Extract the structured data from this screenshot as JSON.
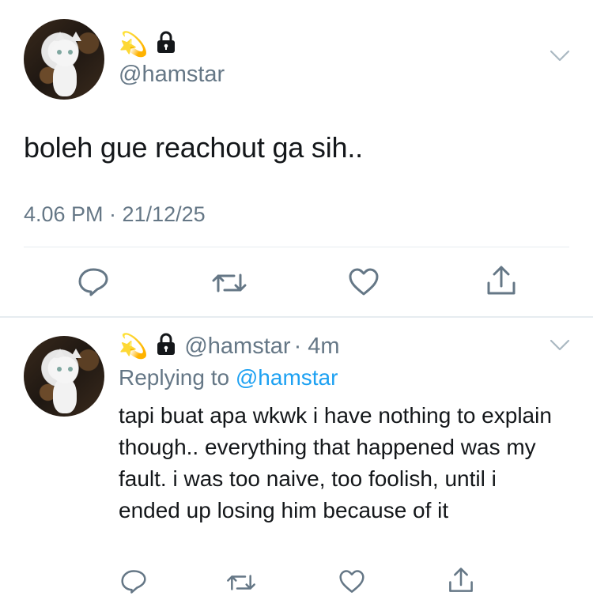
{
  "main_tweet": {
    "emoji": "💫",
    "handle": "@hamstar",
    "text": "boleh gue reachout ga sih..",
    "timestamp": "4.06 PM · 21/12/25"
  },
  "reply_tweet": {
    "emoji": "💫",
    "handle": "@hamstar",
    "time_ago": "· 4m",
    "replying_prefix": "Replying to",
    "replying_handle": "@hamstar",
    "text": "tapi buat apa wkwk i have nothing to explain though.. everything that happened was my fault. i was too naive, too foolish, until i ended up losing him because of it"
  },
  "icons": {
    "reply": "reply-icon",
    "retweet": "retweet-icon",
    "like": "heart-icon",
    "share": "share-icon",
    "more": "chevron-down-icon",
    "lock": "lock-icon"
  },
  "colors": {
    "text": "#14171a",
    "secondary": "#657786",
    "link": "#1da1f2",
    "divider": "#e6ecf0"
  }
}
